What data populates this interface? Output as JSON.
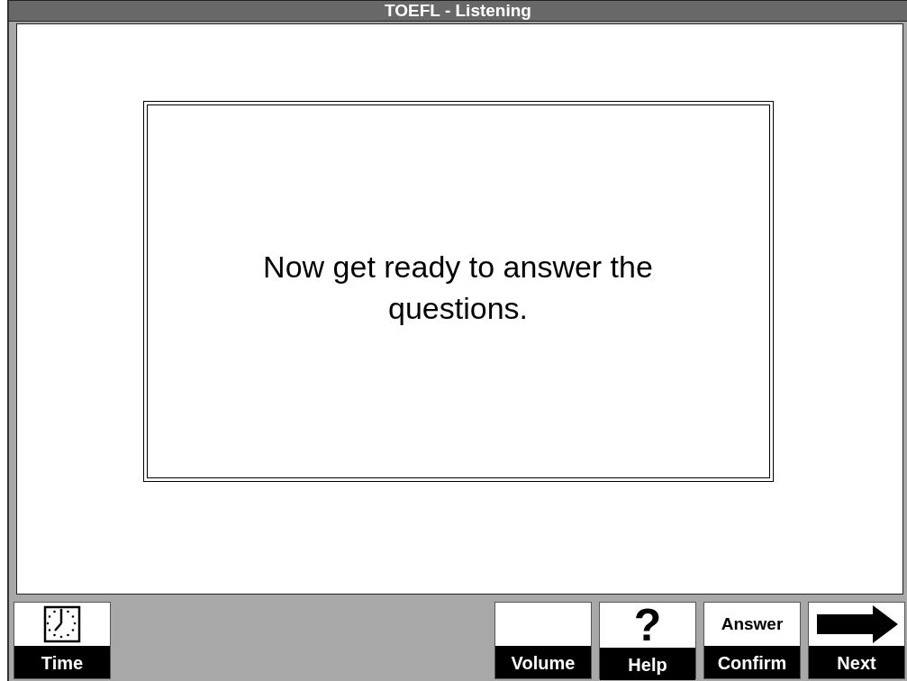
{
  "window": {
    "title": "TOEFL - Listening"
  },
  "message": "Now get ready to answer the questions.",
  "toolbar": {
    "left_buttons": [
      {
        "kind": "clock",
        "label": "Time"
      }
    ],
    "right_buttons": [
      {
        "kind": "blank",
        "label": "Volume"
      },
      {
        "kind": "glyph",
        "glyph": "?",
        "label": "Help"
      },
      {
        "kind": "caption",
        "caption": "Answer",
        "label": "Confirm"
      },
      {
        "kind": "arrow",
        "label": "Next"
      }
    ]
  }
}
